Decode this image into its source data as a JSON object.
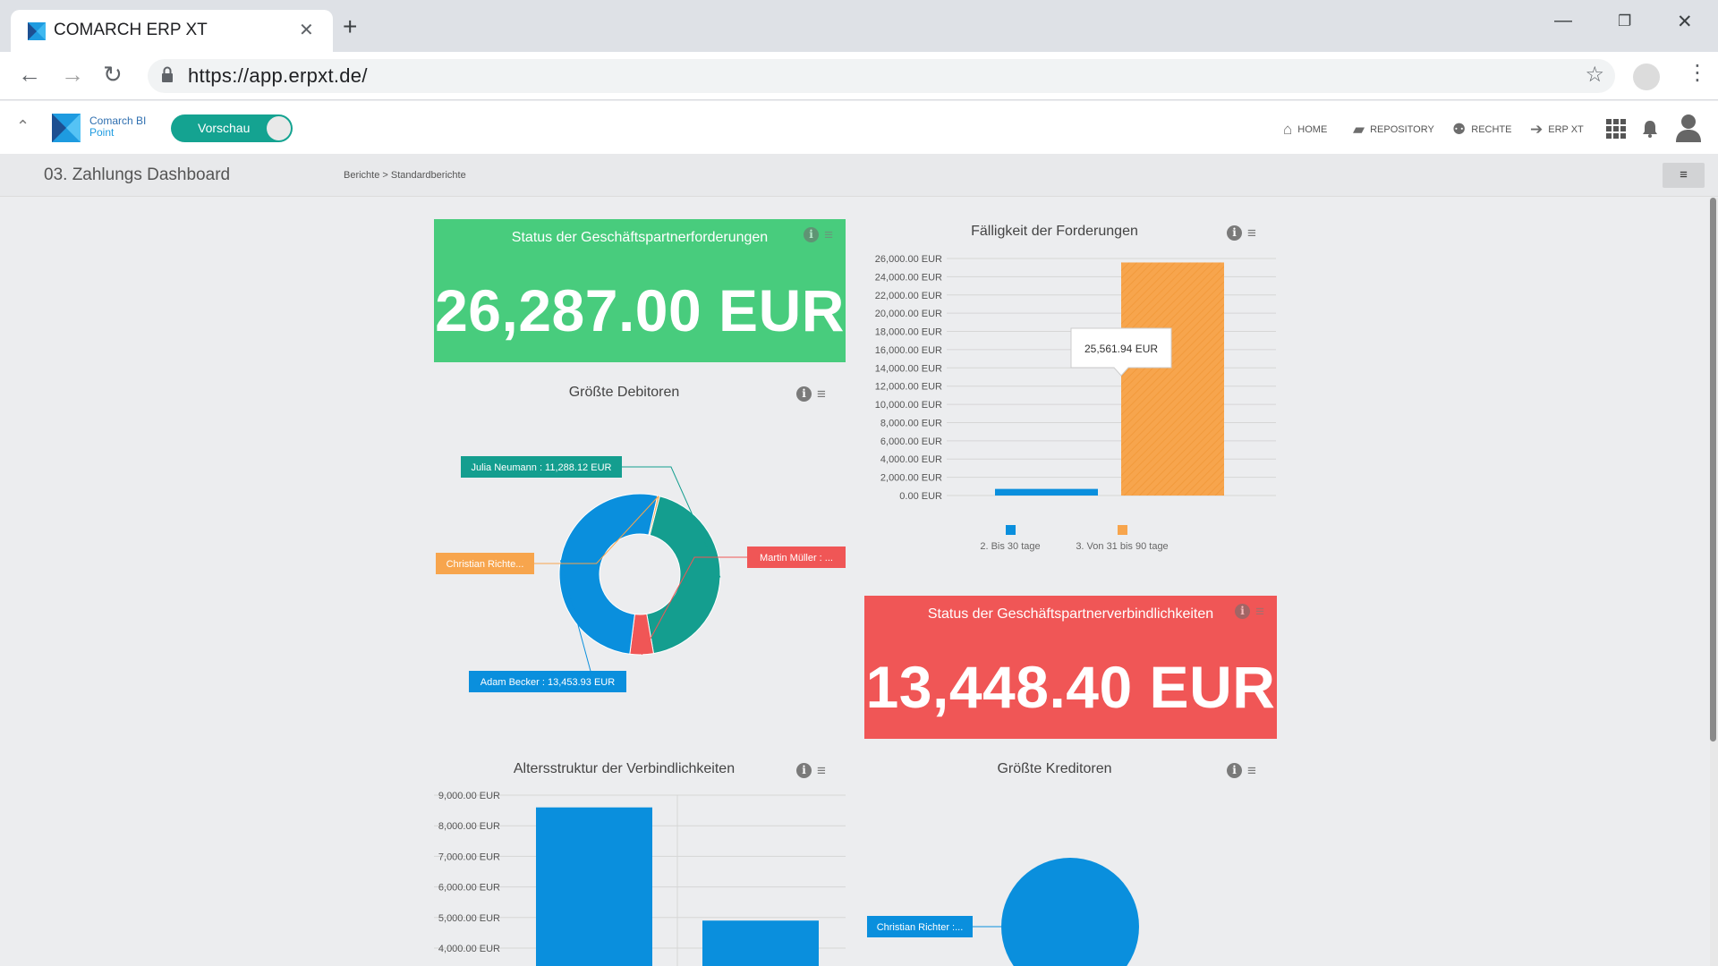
{
  "browser": {
    "tab_title": "COMARCH ERP XT",
    "url": "https://app.erpxt.de/"
  },
  "app": {
    "logo_line1": "Comarch BI",
    "logo_line2": "Point",
    "toggle_label": "Vorschau",
    "nav": {
      "home": "HOME",
      "repository": "REPOSITORY",
      "rechte": "RECHTE",
      "erp": "ERP XT"
    }
  },
  "page": {
    "title": "03. Zahlungs Dashboard",
    "breadcrumb": [
      "Berichte",
      "Standardberichte"
    ]
  },
  "colors": {
    "green": "#48cc7d",
    "red": "#f05656",
    "teal": "#149e8f",
    "blue": "#0a8fdd",
    "orange": "#f7a54d"
  },
  "widgets": {
    "receivables_status": {
      "title": "Status der Geschäftspartnerforderungen",
      "value": "26,287.00 EUR"
    },
    "liabilities_status": {
      "title": "Status der Geschäftspartnerverbindlichkeiten",
      "value": "13,448.40 EUR"
    },
    "top_debtors": {
      "title": "Größte Debitoren"
    },
    "receivables_due": {
      "title": "Fälligkeit der Forderungen"
    },
    "liabilities_age": {
      "title": "Altersstruktur der Verbindlichkeiten"
    },
    "top_creditors": {
      "title": "Größte Kreditoren"
    }
  },
  "chart_data": [
    {
      "id": "top_debtors",
      "type": "pie",
      "donut": true,
      "slices": [
        {
          "label": "Julia Neumann : 11,288.12 EUR",
          "value": 11288.12,
          "color": "#149e8f"
        },
        {
          "label": "Martin Müller : ...",
          "value": 1235.0,
          "color": "#f05656"
        },
        {
          "label": "Adam Becker : 13,453.93 EUR",
          "value": 13453.93,
          "color": "#0a8fdd"
        },
        {
          "label": "Christian Richte...",
          "value": 110.0,
          "color": "#f7a54d"
        }
      ]
    },
    {
      "id": "receivables_due",
      "type": "bar",
      "series": [
        {
          "name": "2. Bis 30 tage",
          "value": 725.06,
          "color": "#0a8fdd"
        },
        {
          "name": "3. Von 31 bis 90 tage",
          "value": 25561.94,
          "color": "#f7a54d"
        }
      ],
      "ylim": [
        0,
        26000
      ],
      "yticks": [
        "0.00 EUR",
        "2,000.00 EUR",
        "4,000.00 EUR",
        "6,000.00 EUR",
        "8,000.00 EUR",
        "10,000.00 EUR",
        "12,000.00 EUR",
        "14,000.00 EUR",
        "16,000.00 EUR",
        "18,000.00 EUR",
        "20,000.00 EUR",
        "22,000.00 EUR",
        "24,000.00 EUR",
        "26,000.00 EUR"
      ],
      "tooltip": "25,561.94 EUR",
      "legend": "bottom"
    },
    {
      "id": "liabilities_age",
      "type": "bar",
      "values": [
        8600,
        4900
      ],
      "ylim_visible": [
        4000,
        9000
      ],
      "yticks": [
        "4,000.00 EUR",
        "5,000.00 EUR",
        "6,000.00 EUR",
        "7,000.00 EUR",
        "8,000.00 EUR",
        "9,000.00 EUR"
      ],
      "color": "#0a8fdd"
    },
    {
      "id": "top_creditors",
      "type": "pie",
      "slices": [
        {
          "label": "Christian Richter :...",
          "value": 13448.4,
          "color": "#0a8fdd"
        }
      ]
    }
  ]
}
